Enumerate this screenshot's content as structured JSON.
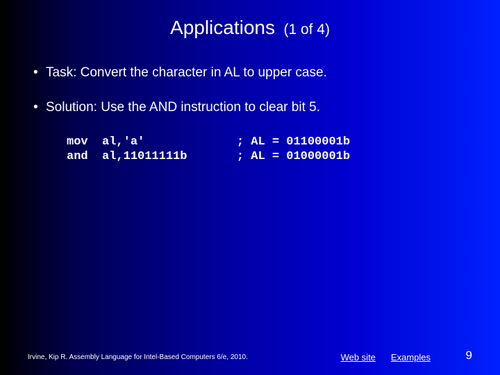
{
  "header": {
    "title": "Applications",
    "subtitle": "(1 of 4)"
  },
  "bullets": [
    "Task: Convert the character in AL to upper case.",
    "Solution: Use the AND instruction to clear bit 5."
  ],
  "code": {
    "line1": "mov  al,'a'             ; AL = 01100001b",
    "line2": "and  al,11011111b       ; AL = 01000001b"
  },
  "footer": {
    "citation": "Irvine, Kip R. Assembly Language for Intel-Based Computers 6/e, 2010.",
    "link_web": "Web site",
    "link_examples": "Examples",
    "page_number": "9"
  }
}
